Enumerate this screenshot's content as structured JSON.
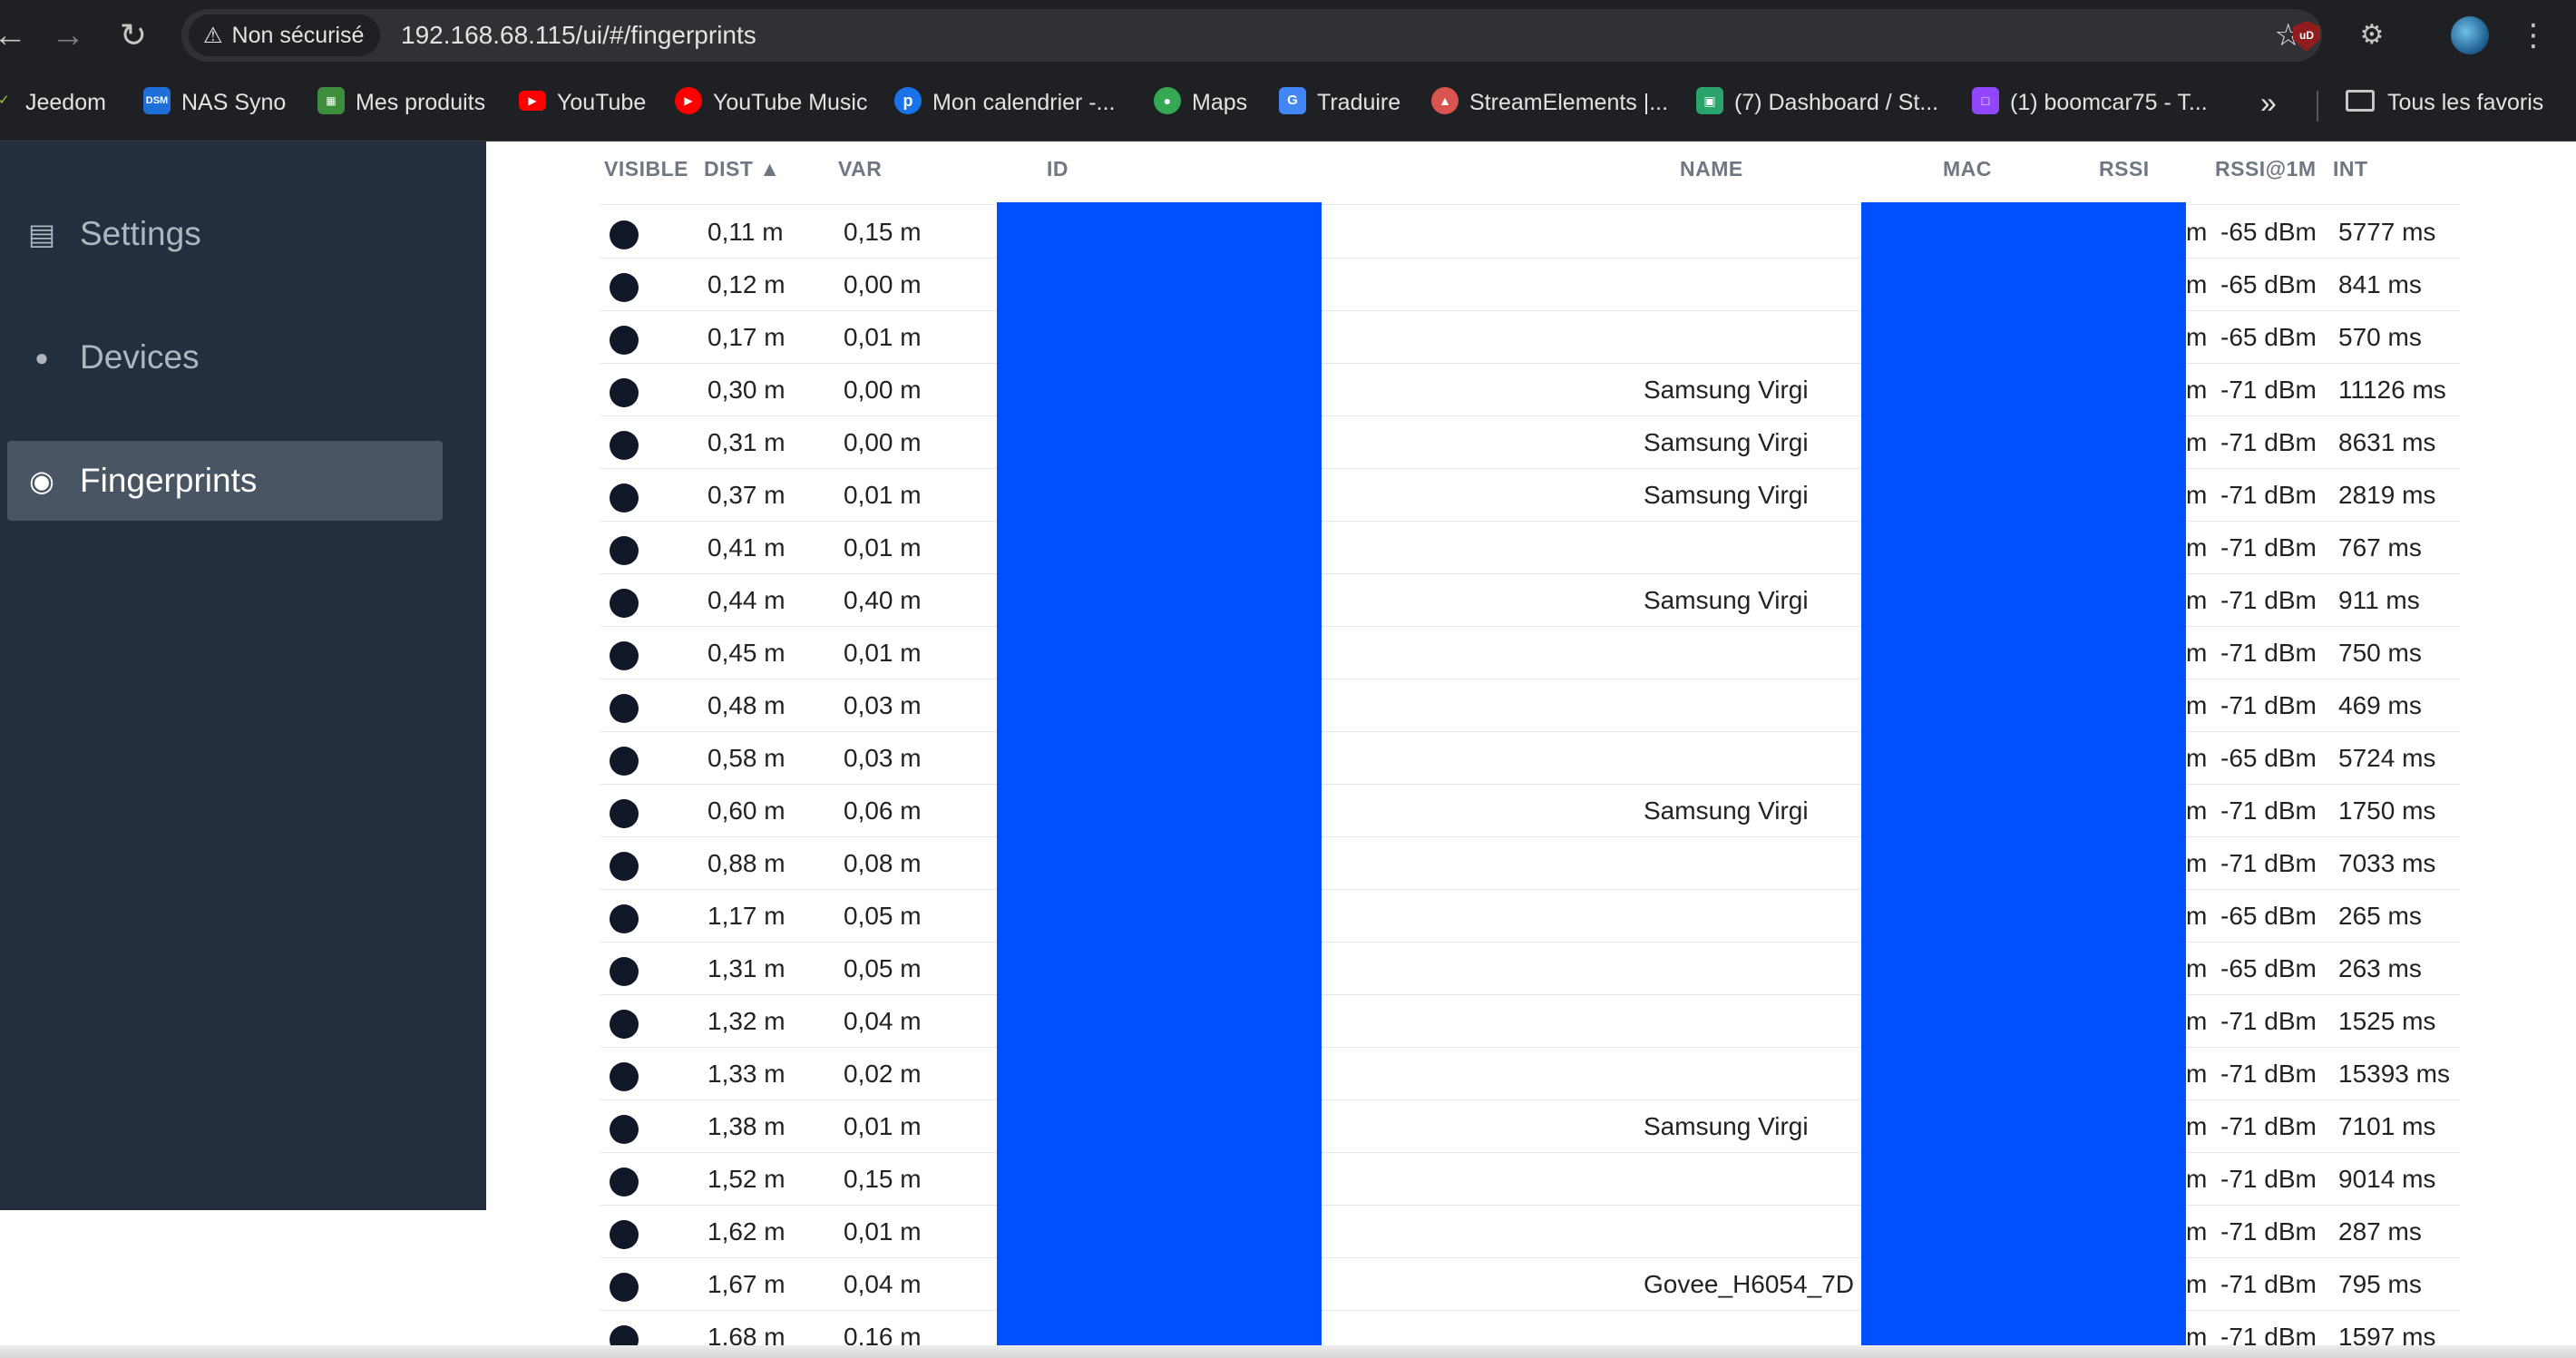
{
  "browser": {
    "security_label": "Non sécurisé",
    "url": "192.168.68.115/ui/#/fingerprints",
    "bookmarks": [
      {
        "label": "Jeedom",
        "icon": "jeedom-icon",
        "color": "#9acd32"
      },
      {
        "label": "NAS Syno",
        "icon": "dsm-icon",
        "color": "#1e6fd9"
      },
      {
        "label": "Mes produits",
        "icon": "products-icon",
        "color": "#3c8d3c"
      },
      {
        "label": "YouTube",
        "icon": "youtube-icon",
        "color": "#ff0000"
      },
      {
        "label": "YouTube Music",
        "icon": "youtube-music-icon",
        "color": "#ff0000"
      },
      {
        "label": "Mon calendrier -...",
        "icon": "calendar-icon",
        "color": "#1a73e8"
      },
      {
        "label": "Maps",
        "icon": "maps-icon",
        "color": "#34a853"
      },
      {
        "label": "Traduire",
        "icon": "translate-icon",
        "color": "#4285f4"
      },
      {
        "label": "StreamElements |...",
        "icon": "streamelements-icon",
        "color": "#d9534f"
      },
      {
        "label": "(7) Dashboard / St...",
        "icon": "dashboard-icon",
        "color": "#29a36a"
      },
      {
        "label": "(1) boomcar75 - T...",
        "icon": "twitch-icon",
        "color": "#9146ff"
      }
    ],
    "all_bookmarks_label": "Tous les favoris"
  },
  "sidebar": {
    "items": [
      {
        "label": "Settings",
        "icon": "settings-card-icon",
        "active": false
      },
      {
        "label": "Devices",
        "icon": "android-icon",
        "active": false
      },
      {
        "label": "Fingerprints",
        "icon": "fingerprint-icon",
        "active": true
      }
    ]
  },
  "table": {
    "columns": {
      "visible": "VISIBLE",
      "dist": "DIST ▲",
      "var": "VAR",
      "id": "ID",
      "name": "NAME",
      "mac": "MAC",
      "rssi": "RSSI",
      "rssi1m": "RSSI@1M",
      "int": "INT"
    },
    "rssi_truncated_suffix": "m",
    "rows": [
      {
        "dist": "0,11 m",
        "var": "0,15 m",
        "name": "",
        "rssi1m": "-65 dBm",
        "int": "5777 ms"
      },
      {
        "dist": "0,12 m",
        "var": "0,00 m",
        "name": "",
        "rssi1m": "-65 dBm",
        "int": "841 ms"
      },
      {
        "dist": "0,17 m",
        "var": "0,01 m",
        "name": "",
        "rssi1m": "-65 dBm",
        "int": "570 ms"
      },
      {
        "dist": "0,30 m",
        "var": "0,00 m",
        "name": "Samsung Virgi",
        "rssi1m": "-71 dBm",
        "int": "11126 ms"
      },
      {
        "dist": "0,31 m",
        "var": "0,00 m",
        "name": "Samsung Virgi",
        "rssi1m": "-71 dBm",
        "int": "8631 ms"
      },
      {
        "dist": "0,37 m",
        "var": "0,01 m",
        "name": "Samsung Virgi",
        "rssi1m": "-71 dBm",
        "int": "2819 ms"
      },
      {
        "dist": "0,41 m",
        "var": "0,01 m",
        "name": "",
        "rssi1m": "-71 dBm",
        "int": "767 ms"
      },
      {
        "dist": "0,44 m",
        "var": "0,40 m",
        "name": "Samsung Virgi",
        "rssi1m": "-71 dBm",
        "int": "911 ms"
      },
      {
        "dist": "0,45 m",
        "var": "0,01 m",
        "name": "",
        "rssi1m": "-71 dBm",
        "int": "750 ms"
      },
      {
        "dist": "0,48 m",
        "var": "0,03 m",
        "name": "",
        "rssi1m": "-71 dBm",
        "int": "469 ms"
      },
      {
        "dist": "0,58 m",
        "var": "0,03 m",
        "name": "",
        "rssi1m": "-65 dBm",
        "int": "5724 ms"
      },
      {
        "dist": "0,60 m",
        "var": "0,06 m",
        "name": "Samsung Virgi",
        "rssi1m": "-71 dBm",
        "int": "1750 ms"
      },
      {
        "dist": "0,88 m",
        "var": "0,08 m",
        "name": "",
        "rssi1m": "-71 dBm",
        "int": "7033 ms"
      },
      {
        "dist": "1,17 m",
        "var": "0,05 m",
        "name": "",
        "rssi1m": "-65 dBm",
        "int": "265 ms"
      },
      {
        "dist": "1,31 m",
        "var": "0,05 m",
        "name": "",
        "rssi1m": "-65 dBm",
        "int": "263 ms"
      },
      {
        "dist": "1,32 m",
        "var": "0,04 m",
        "name": "",
        "rssi1m": "-71 dBm",
        "int": "1525 ms"
      },
      {
        "dist": "1,33 m",
        "var": "0,02 m",
        "name": "",
        "rssi1m": "-71 dBm",
        "int": "15393 ms"
      },
      {
        "dist": "1,38 m",
        "var": "0,01 m",
        "name": "Samsung Virgi",
        "rssi1m": "-71 dBm",
        "int": "7101 ms"
      },
      {
        "dist": "1,52 m",
        "var": "0,15 m",
        "name": "",
        "rssi1m": "-71 dBm",
        "int": "9014 ms"
      },
      {
        "dist": "1,62 m",
        "var": "0,01 m",
        "name": "",
        "rssi1m": "-71 dBm",
        "int": "287 ms"
      },
      {
        "dist": "1,67 m",
        "var": "0,04 m",
        "name": "Govee_H6054_7D",
        "rssi1m": "-71 dBm",
        "int": "795 ms"
      },
      {
        "dist": "1,68 m",
        "var": "0,16 m",
        "name": "",
        "rssi1m": "-71 dBm",
        "int": "1597 ms"
      }
    ]
  },
  "colors": {
    "sidebar_bg": "#232f3e",
    "sidebar_active_bg": "#4a5563",
    "redaction": "#0050ff",
    "visible_dot": "#111827"
  }
}
